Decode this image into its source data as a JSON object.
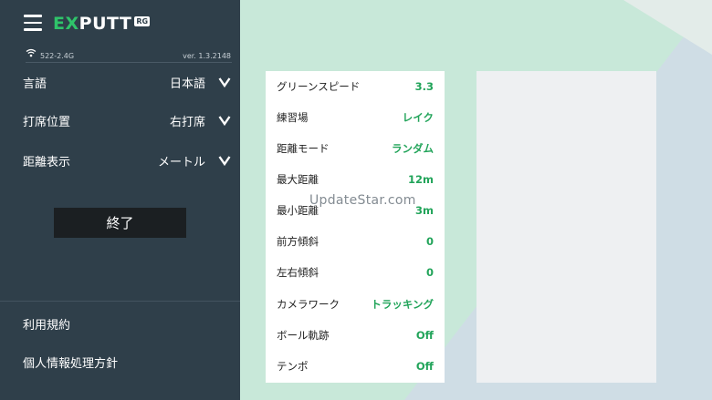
{
  "header": {
    "logo_ex": "EX",
    "logo_rest": "PUTT",
    "logo_badge": "RG"
  },
  "status": {
    "wifi_ssid": "522-2.4G",
    "version": "ver. 1.3.2148"
  },
  "settings": [
    {
      "label": "言語",
      "value": "日本語"
    },
    {
      "label": "打席位置",
      "value": "右打席"
    },
    {
      "label": "距離表示",
      "value": "メートル"
    }
  ],
  "quit_label": "終了",
  "links": {
    "terms": "利用規約",
    "privacy": "個人情報処理方針"
  },
  "panel": {
    "rows": [
      {
        "label": "グリーンスピード",
        "value": "3.3"
      },
      {
        "label": "練習場",
        "value": "レイク"
      },
      {
        "label": "距離モード",
        "value": "ランダム"
      },
      {
        "label": "最大距離",
        "value": "12m"
      },
      {
        "label": "最小距離",
        "value": "3m"
      },
      {
        "label": "前方傾斜",
        "value": "0"
      },
      {
        "label": "左右傾斜",
        "value": "0"
      },
      {
        "label": "カメラワーク",
        "value": "トラッキング"
      },
      {
        "label": "ボール軌跡",
        "value": "Off"
      },
      {
        "label": "テンポ",
        "value": "Off"
      }
    ]
  },
  "watermark": "UpdateStar.com",
  "colors": {
    "sidebar_bg": "#2f3f4a",
    "accent_green": "#22a45a",
    "main_bg": "#c8e8d9"
  }
}
